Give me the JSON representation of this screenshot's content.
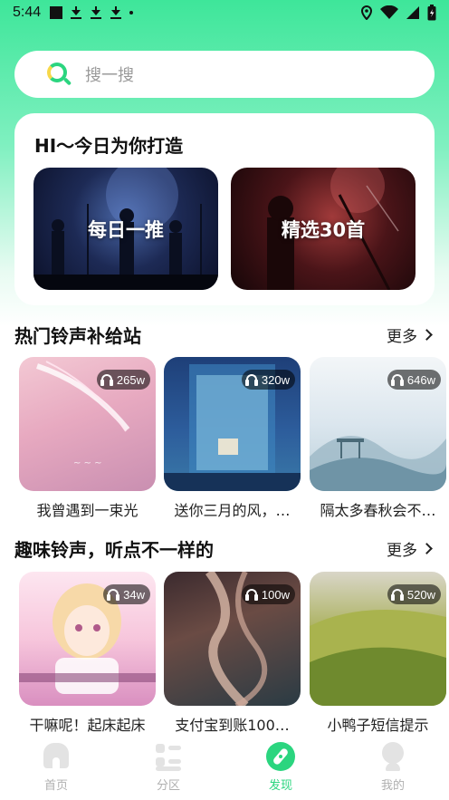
{
  "status_bar": {
    "time": "5:44"
  },
  "search": {
    "placeholder": "搜一搜"
  },
  "today": {
    "title": "HI～今日为你打造",
    "tiles": [
      {
        "label": "每日一推"
      },
      {
        "label": "精选30首"
      }
    ]
  },
  "hot_section": {
    "title": "热门铃声补给站",
    "more_label": "更多",
    "items": [
      {
        "title": "我曾遇到一束光",
        "plays": "265w"
      },
      {
        "title": "送你三月的风，…",
        "plays": "320w"
      },
      {
        "title": "隔太多春秋会不…",
        "plays": "646w"
      }
    ]
  },
  "fun_section": {
    "title": "趣味铃声，听点不一样的",
    "more_label": "更多",
    "items": [
      {
        "title": "干嘛呢！起床起床",
        "plays": "34w"
      },
      {
        "title": "支付宝到账100…",
        "plays": "100w"
      },
      {
        "title": "小鸭子短信提示",
        "plays": "520w"
      }
    ]
  },
  "tabbar": {
    "tabs": [
      {
        "label": "首页",
        "icon": "home-icon"
      },
      {
        "label": "分区",
        "icon": "category-icon"
      },
      {
        "label": "发现",
        "icon": "compass-icon",
        "active": true
      },
      {
        "label": "我的",
        "icon": "profile-icon"
      }
    ]
  },
  "colors": {
    "accent": "#2bd57f",
    "header_green": "#3ee69a"
  }
}
